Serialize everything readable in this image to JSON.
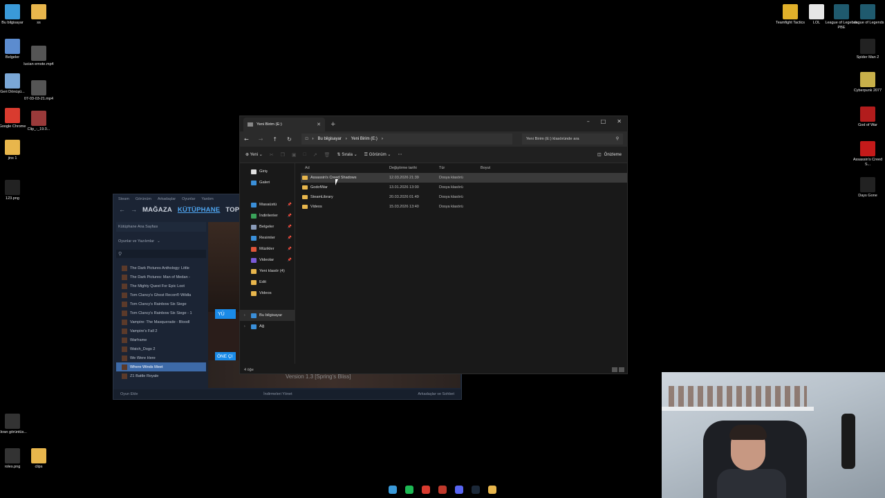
{
  "desktop_left": [
    {
      "label": "Bu bilgisayar",
      "icon": "monitor-icon",
      "color": "#3a9ad9"
    },
    {
      "label": "ss",
      "icon": "folder-icon",
      "color": "#e8b64c"
    },
    {
      "label": "Belgeler",
      "icon": "documents-icon",
      "color": "#5c8ccf"
    },
    {
      "label": "lucian emote.mp4",
      "icon": "video-file-icon",
      "color": "#555"
    },
    {
      "label": "Geri Dönüşü...",
      "icon": "recycle-bin-icon",
      "color": "#7aa7d6"
    },
    {
      "label": "07-03-03-21.mp4",
      "icon": "video-file-icon",
      "color": "#555"
    },
    {
      "label": "Google Chrome",
      "icon": "chrome-icon",
      "color": "#d93b2f"
    },
    {
      "label": "Clip_-_19.0...",
      "icon": "video-file-icon",
      "color": "#9a3a3a"
    },
    {
      "label": "jinx 1",
      "icon": "folder-icon",
      "color": "#e8b64c"
    },
    {
      "label": "123.png",
      "icon": "image-file-icon",
      "color": "#222"
    },
    {
      "label": "Ekran görüntüs...",
      "icon": "image-file-icon",
      "color": "#333"
    },
    {
      "label": "roles.png",
      "icon": "image-file-icon",
      "color": "#333"
    },
    {
      "label": "clips",
      "icon": "folder-icon",
      "color": "#e8b64c"
    }
  ],
  "desktop_right": [
    {
      "label": "Teamfight Tactics",
      "icon": "tft-icon",
      "color": "#e0b02a"
    },
    {
      "label": "LOL",
      "icon": "file-icon",
      "color": "#e6e6e6"
    },
    {
      "label": "League of Legends PBE",
      "icon": "league-icon",
      "color": "#1f5a6e"
    },
    {
      "label": "League of Legends",
      "icon": "league-icon",
      "color": "#1f5a6e"
    },
    {
      "label": "Spider Man 2",
      "icon": "spiderman-icon",
      "color": "#222"
    },
    {
      "label": "Cyberpunk 2077",
      "icon": "cyberpunk-icon",
      "color": "#c8b04a"
    },
    {
      "label": "God of War",
      "icon": "gow-icon",
      "color": "#b21c1c"
    },
    {
      "label": "Assassin's Creed S...",
      "icon": "ac-icon",
      "color": "#c41a1a"
    },
    {
      "label": "Days Gone",
      "icon": "daysgone-icon",
      "color": "#222"
    }
  ],
  "steam": {
    "menu": [
      "Steam",
      "Görünüm",
      "Arkadaşlar",
      "Oyunlar",
      "Yardım"
    ],
    "nav": [
      "MAĞAZA",
      "KÜTÜPHANE",
      "TOPLULUK"
    ],
    "home_label": "Kütüphane Ana Sayfası",
    "filter_label": "Oyunlar ve Yazılımlar",
    "games": [
      "The Dark Pictures Anthology: Little",
      "The Dark Pictures: Man of Medan -",
      "The Mighty Quest For Epic Loot",
      "Tom Clancy's Ghost Recon® Wildla",
      "Tom Clancy's Rainbow Six Siege",
      "Tom Clancy's Rainbow Six Siege - 1",
      "Vampire: The Masquerade - Bloodl",
      "Vampire's Fall 2",
      "Warframe",
      "Watch_Dogs 2",
      "We Were Here",
      "Where Winds Meet",
      "Z1 Battle Royale"
    ],
    "selected_game_index": 11,
    "install_label": "YÜ",
    "store_label": "Mağaza",
    "featured_label": "ÖNE ÇI",
    "version_text": "Version 1.3 [Spring's Bliss]",
    "add_game": "Oyun Ekle",
    "downloads": "İndirmeleri Yönet",
    "friends": "Arkadaşlar ve Sohbet"
  },
  "explorer": {
    "tab_title": "Yeni Birim (E:)",
    "breadcrumb": [
      "Bu bilgisayar",
      "Yeni Birim (E:)"
    ],
    "search_placeholder": "Yeni Birim (E:) klasöründe ara",
    "toolbar": {
      "new": "Yeni",
      "sort": "Sırala",
      "view": "Görünüm",
      "preview": "Önizleme"
    },
    "nav": {
      "top": [
        {
          "label": "Giriş",
          "icon": "home-icon",
          "color": "#e0e0e0"
        },
        {
          "label": "Galeri",
          "icon": "gallery-icon",
          "color": "#3a8fd9"
        }
      ],
      "quick": [
        {
          "label": "Masaüstü",
          "icon": "desktop-icon",
          "color": "#3a8fd9"
        },
        {
          "label": "İndirilenler",
          "icon": "download-icon",
          "color": "#3aa35a"
        },
        {
          "label": "Belgeler",
          "icon": "documents-icon",
          "color": "#8a9bb8"
        },
        {
          "label": "Resimler",
          "icon": "pictures-icon",
          "color": "#3a8fd9"
        },
        {
          "label": "Müzikler",
          "icon": "music-icon",
          "color": "#e0553a"
        },
        {
          "label": "Videolar",
          "icon": "videos-icon",
          "color": "#7a5ad9"
        },
        {
          "label": "Yeni klasör (4)",
          "icon": "folder-icon",
          "color": "#e8b64c"
        },
        {
          "label": "Edit",
          "icon": "folder-icon",
          "color": "#e8b64c"
        },
        {
          "label": "Videos",
          "icon": "folder-icon",
          "color": "#e8b64c"
        }
      ],
      "bottom": [
        {
          "label": "Bu bilgisayar",
          "icon": "monitor-icon",
          "color": "#3a8fd9"
        },
        {
          "label": "Ağ",
          "icon": "network-icon",
          "color": "#3a8fd9"
        }
      ]
    },
    "columns": [
      "Ad",
      "Değiştirme tarihi",
      "Tür",
      "Boyut"
    ],
    "files": [
      {
        "name": "Assassin's Creed Shadows",
        "date": "12.03.2026 21:39",
        "type": "Dosya klasörü",
        "size": ""
      },
      {
        "name": "GodofWar",
        "date": "13.01.2026 13:00",
        "type": "Dosya klasörü",
        "size": ""
      },
      {
        "name": "SteamLibrary",
        "date": "20.03.2026 01:49",
        "type": "Dosya klasörü",
        "size": ""
      },
      {
        "name": "Videos",
        "date": "15.03.2026 13:40",
        "type": "Dosya klasörü",
        "size": ""
      }
    ],
    "status": "4 öğe"
  },
  "taskbar": [
    {
      "icon": "start-icon",
      "color": "#3a9ad9"
    },
    {
      "icon": "spotify-icon",
      "color": "#1db954"
    },
    {
      "icon": "chrome-icon",
      "color": "#d93b2f"
    },
    {
      "icon": "chrome-icon",
      "color": "#c0392b"
    },
    {
      "icon": "discord-icon",
      "color": "#5865f2"
    },
    {
      "icon": "steam-icon",
      "color": "#1b2838"
    },
    {
      "icon": "file-explorer-icon",
      "color": "#e8b64c"
    }
  ]
}
